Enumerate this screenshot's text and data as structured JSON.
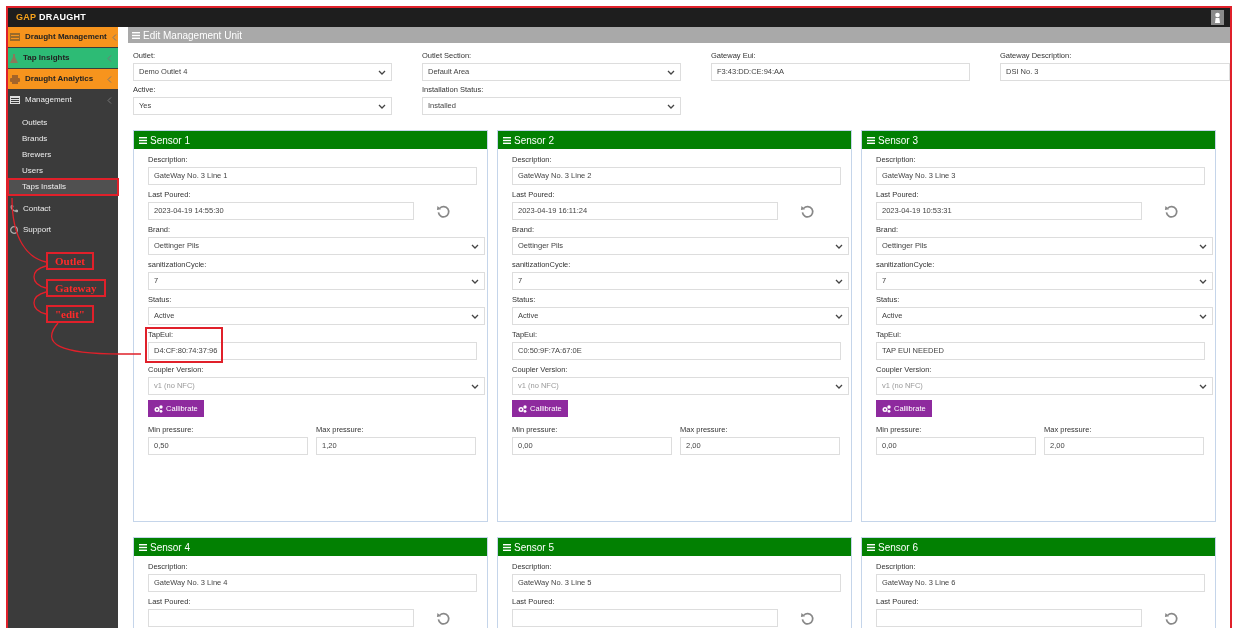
{
  "header": {
    "logo_accent": "GAP",
    "logo_text": "DRAUGHT"
  },
  "sidebar": {
    "items": [
      {
        "label": "Draught Management",
        "color": "#f7941d",
        "kind": "group"
      },
      {
        "label": "Tap Insights",
        "color": "#2dbb75",
        "kind": "group"
      },
      {
        "label": "Draught Analytics",
        "color": "#f7941d",
        "kind": "group"
      },
      {
        "label": "Management",
        "kind": "group",
        "expanded": true,
        "children": [
          {
            "label": "Outlets",
            "selected": false,
            "highlighted": false
          },
          {
            "label": "Brands",
            "selected": false,
            "highlighted": false
          },
          {
            "label": "Brewers",
            "selected": false,
            "highlighted": false
          },
          {
            "label": "Users",
            "selected": false,
            "highlighted": false
          },
          {
            "label": "Taps Installs",
            "selected": true,
            "highlighted": true
          }
        ]
      },
      {
        "label": "Contact",
        "kind": "link"
      },
      {
        "label": "Support",
        "kind": "link"
      }
    ]
  },
  "unit_form": {
    "title": "Edit Management Unit",
    "fields": [
      {
        "label": "Outlet:",
        "value": "Demo Outlet 4",
        "kind": "select"
      },
      {
        "label": "Outlet Section:",
        "value": "Default Area",
        "kind": "select"
      },
      {
        "label": "Gateway Eui:",
        "value": "F3:43:DD:CE:94:AA",
        "kind": "text"
      },
      {
        "label": "Gateway Description:",
        "value": "DSI No. 3",
        "kind": "text"
      },
      {
        "label": "Active:",
        "value": "Yes",
        "kind": "select"
      },
      {
        "label": "Installation Status:",
        "value": "Installed",
        "kind": "select"
      }
    ]
  },
  "sensors": [
    {
      "title": "Sensor 1",
      "fields": [
        {
          "label": "Description:",
          "value": "GateWay No. 3 Line 1",
          "kind": "text",
          "disabled": false,
          "highlighted": false
        },
        {
          "label": "Last Poured:",
          "value": "2023-04-19 14:55:30",
          "kind": "reset",
          "disabled": false,
          "highlighted": false
        },
        {
          "label": "Brand:",
          "value": "Oettinger Pils",
          "kind": "select",
          "disabled": false,
          "highlighted": false
        },
        {
          "label": "sanitizationCycle:",
          "value": "7",
          "kind": "select",
          "disabled": false,
          "highlighted": false
        },
        {
          "label": "Status:",
          "value": "Active",
          "kind": "select",
          "disabled": false,
          "highlighted": false
        },
        {
          "label": "TapEui:",
          "value": "D4:CF:80:74:37:96",
          "kind": "text",
          "disabled": false,
          "highlighted": true
        },
        {
          "label": "Coupler Version:",
          "value": "v1 (no NFC)",
          "kind": "select",
          "disabled": true,
          "highlighted": false
        }
      ],
      "button": "Callibrate",
      "pressures": [
        {
          "label": "Min pressure:",
          "value": "0,50"
        },
        {
          "label": "Max pressure:",
          "value": "1,20"
        }
      ]
    },
    {
      "title": "Sensor 2",
      "fields": [
        {
          "label": "Description:",
          "value": "GateWay No. 3 Line 2",
          "kind": "text",
          "disabled": false,
          "highlighted": false
        },
        {
          "label": "Last Poured:",
          "value": "2023-04-19 16:11:24",
          "kind": "reset",
          "disabled": false,
          "highlighted": false
        },
        {
          "label": "Brand:",
          "value": "Oettinger Pils",
          "kind": "select",
          "disabled": false,
          "highlighted": false
        },
        {
          "label": "sanitizationCycle:",
          "value": "7",
          "kind": "select",
          "disabled": false,
          "highlighted": false
        },
        {
          "label": "Status:",
          "value": "Active",
          "kind": "select",
          "disabled": false,
          "highlighted": false
        },
        {
          "label": "TapEui:",
          "value": "C0:50:9F:7A:67:0E",
          "kind": "text",
          "disabled": false,
          "highlighted": false
        },
        {
          "label": "Coupler Version:",
          "value": "v1 (no NFC)",
          "kind": "select",
          "disabled": true,
          "highlighted": false
        }
      ],
      "button": "Callibrate",
      "pressures": [
        {
          "label": "Min pressure:",
          "value": "0,00"
        },
        {
          "label": "Max pressure:",
          "value": "2,00"
        }
      ]
    },
    {
      "title": "Sensor 3",
      "fields": [
        {
          "label": "Description:",
          "value": "GateWay No. 3 Line 3",
          "kind": "text",
          "disabled": false,
          "highlighted": false
        },
        {
          "label": "Last Poured:",
          "value": "2023-04-19 10:53:31",
          "kind": "reset",
          "disabled": false,
          "highlighted": false
        },
        {
          "label": "Brand:",
          "value": "Oettinger Pils",
          "kind": "select",
          "disabled": false,
          "highlighted": false
        },
        {
          "label": "sanitizationCycle:",
          "value": "7",
          "kind": "select",
          "disabled": false,
          "highlighted": false
        },
        {
          "label": "Status:",
          "value": "Active",
          "kind": "select",
          "disabled": false,
          "highlighted": false
        },
        {
          "label": "TapEui:",
          "value": "TAP EUI NEEDED",
          "kind": "text",
          "disabled": false,
          "highlighted": false
        },
        {
          "label": "Coupler Version:",
          "value": "v1 (no NFC)",
          "kind": "select",
          "disabled": true,
          "highlighted": false
        }
      ],
      "button": "Callibrate",
      "pressures": [
        {
          "label": "Min pressure:",
          "value": "0,00"
        },
        {
          "label": "Max pressure:",
          "value": "2,00"
        }
      ]
    },
    {
      "title": "Sensor 4",
      "fields": [
        {
          "label": "Description:",
          "value": "GateWay No. 3 Line 4",
          "kind": "text",
          "disabled": false,
          "highlighted": false
        },
        {
          "label": "Last Poured:",
          "kind": "reset",
          "highlighted": false
        }
      ]
    },
    {
      "title": "Sensor 5",
      "fields": [
        {
          "label": "Description:",
          "value": "GateWay No. 3 Line 5",
          "kind": "text",
          "disabled": false,
          "highlighted": false
        },
        {
          "label": "Last Poured:",
          "kind": "reset",
          "highlighted": false
        }
      ]
    },
    {
      "title": "Sensor 6",
      "fields": [
        {
          "label": "Description:",
          "value": "GateWay No. 3 Line 6",
          "kind": "text",
          "disabled": false,
          "highlighted": false
        },
        {
          "label": "Last Poured:",
          "kind": "reset",
          "highlighted": false
        }
      ]
    }
  ],
  "annotations": {
    "labels": [
      "Outlet",
      "Gateway",
      "\"edit\""
    ]
  }
}
